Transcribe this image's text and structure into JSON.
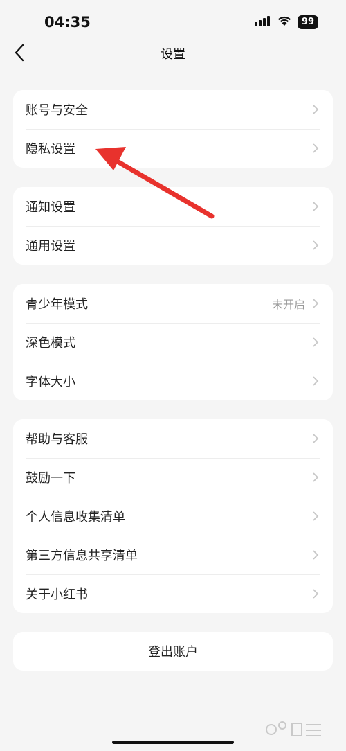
{
  "status_bar": {
    "time": "04:35",
    "battery": "99",
    "signal_icon": "signal-icon",
    "wifi_icon": "wifi-icon"
  },
  "nav": {
    "title": "设置",
    "back_icon": "chevron-left-icon"
  },
  "groups": [
    {
      "items": [
        {
          "label": "账号与安全"
        },
        {
          "label": "隐私设置"
        }
      ]
    },
    {
      "items": [
        {
          "label": "通知设置"
        },
        {
          "label": "通用设置"
        }
      ]
    },
    {
      "items": [
        {
          "label": "青少年模式",
          "value": "未开启"
        },
        {
          "label": "深色模式"
        },
        {
          "label": "字体大小"
        }
      ]
    },
    {
      "items": [
        {
          "label": "帮助与客服"
        },
        {
          "label": "鼓励一下"
        },
        {
          "label": "个人信息收集清单"
        },
        {
          "label": "第三方信息共享清单"
        },
        {
          "label": "关于小红书"
        }
      ]
    }
  ],
  "logout": {
    "label": "登出账户"
  },
  "annotation": {
    "color": "#e8322d"
  },
  "colors": {
    "background": "#f5f5f5",
    "card": "#ffffff",
    "chevron": "#c7c7c7"
  }
}
